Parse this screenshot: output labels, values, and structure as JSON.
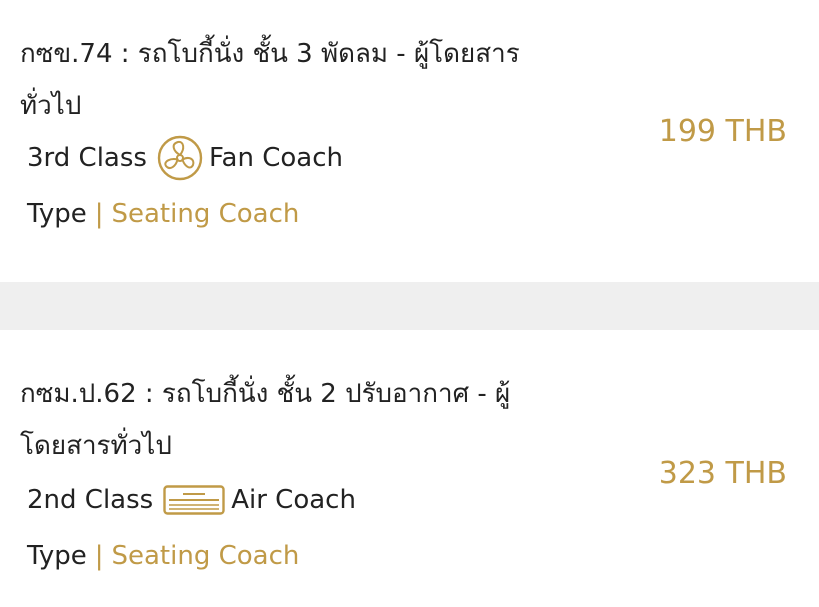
{
  "tickets": [
    {
      "title": "กซข.74 : รถโบกี้นั่ง ชั้น 3 พัดลม - ผู้โดยสารทั่วไป",
      "class_label": "3rd Class",
      "coach_icon": "fan-icon",
      "coach_label": "Fan Coach",
      "type_label": "Type",
      "type_separator": "|",
      "type_value": "Seating Coach",
      "price": "199 THB"
    },
    {
      "title": "กซม.ป.62 : รถโบกี้นั่ง ชั้น 2 ปรับอากาศ - ผู้โดยสารทั่วไป",
      "class_label": "2nd Class",
      "coach_icon": "air-conditioner-icon",
      "coach_label": "Air Coach",
      "type_label": "Type",
      "type_separator": "|",
      "type_value": "Seating Coach",
      "price": "323 THB"
    }
  ],
  "colors": {
    "accent": "#c09a47",
    "text": "#222222",
    "separator": "#efefef"
  }
}
